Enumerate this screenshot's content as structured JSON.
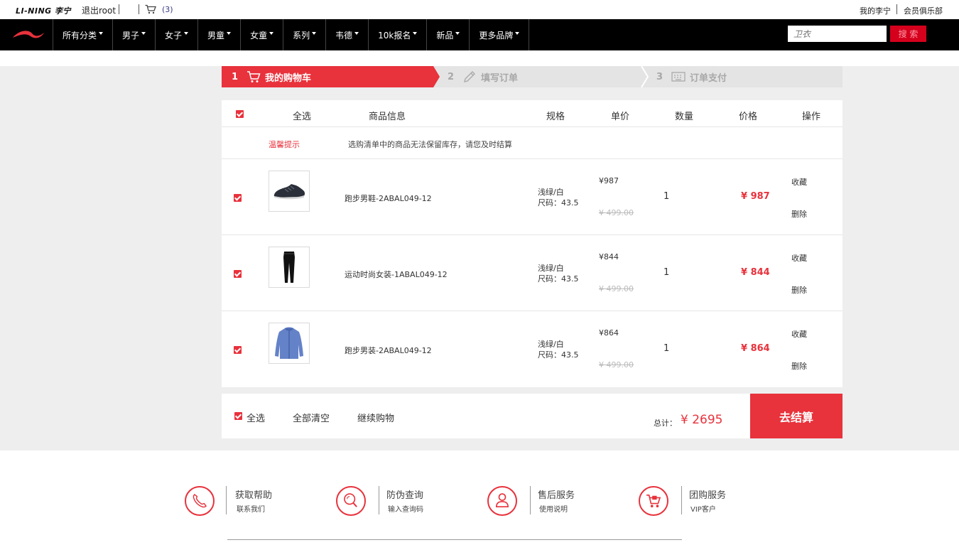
{
  "topbar": {
    "brand": "LI-NING 李宁",
    "logout": "退出root",
    "cart_count": "(3)",
    "my_lining": "我的李宁",
    "club": "会员俱乐部"
  },
  "nav": {
    "items": [
      {
        "label": "所有分类"
      },
      {
        "label": "男子"
      },
      {
        "label": "女子"
      },
      {
        "label": "男童"
      },
      {
        "label": "女童"
      },
      {
        "label": "系列"
      },
      {
        "label": "韦德"
      },
      {
        "label": "10k报名"
      },
      {
        "label": "新品"
      },
      {
        "label": "更多品牌"
      }
    ],
    "search_placeholder": "卫衣",
    "search_button": "搜 索"
  },
  "steps": [
    {
      "num": "1",
      "label": "我的购物车"
    },
    {
      "num": "2",
      "label": "填写订单"
    },
    {
      "num": "3",
      "label": "订单支付"
    }
  ],
  "table": {
    "headers": {
      "select_all": "全选",
      "product": "商品信息",
      "spec": "规格",
      "unit_price": "单价",
      "quantity": "数量",
      "price": "价格",
      "actions": "操作"
    },
    "tip_label": "温馨提示",
    "tip_text": "选购清单中的商品无法保留库存，请您及时结算"
  },
  "items": [
    {
      "name": "跑步男鞋-2ABAL049-12",
      "color": "浅绿/白",
      "size": "尺码：43.5",
      "price": "¥987",
      "original": "¥ 499.00",
      "qty": "1",
      "total": "¥ 987",
      "fav": "收藏",
      "delete": "删除"
    },
    {
      "name": "运动时尚女装-1ABAL049-12",
      "color": "浅绿/白",
      "size": "尺码：43.5",
      "price": "¥844",
      "original": "¥ 499.00",
      "qty": "1",
      "total": "¥ 844",
      "fav": "收藏",
      "delete": "删除"
    },
    {
      "name": "跑步男装-2ABAL049-12",
      "color": "浅绿/白",
      "size": "尺码：43.5",
      "price": "¥864",
      "original": "¥ 499.00",
      "qty": "1",
      "total": "¥ 864",
      "fav": "收藏",
      "delete": "删除"
    }
  ],
  "footbar": {
    "select_all": "全选",
    "clear_all": "全部清空",
    "continue": "继续购物",
    "total_label": "总计：",
    "total_value": "¥ 2695",
    "checkout": "去结算"
  },
  "services": [
    {
      "title": "获取帮助",
      "sub": "联系我们",
      "icon": "phone-icon"
    },
    {
      "title": "防伪查询",
      "sub": "输入查询码",
      "icon": "magnifier-icon"
    },
    {
      "title": "售后服务",
      "sub": "使用说明",
      "icon": "person-icon"
    },
    {
      "title": "团购服务",
      "sub": "VIP客户",
      "icon": "cart-icon"
    }
  ],
  "colors": {
    "accent": "#e8323c",
    "nav_bg": "#000000",
    "page_bg": "#eeeeee"
  }
}
